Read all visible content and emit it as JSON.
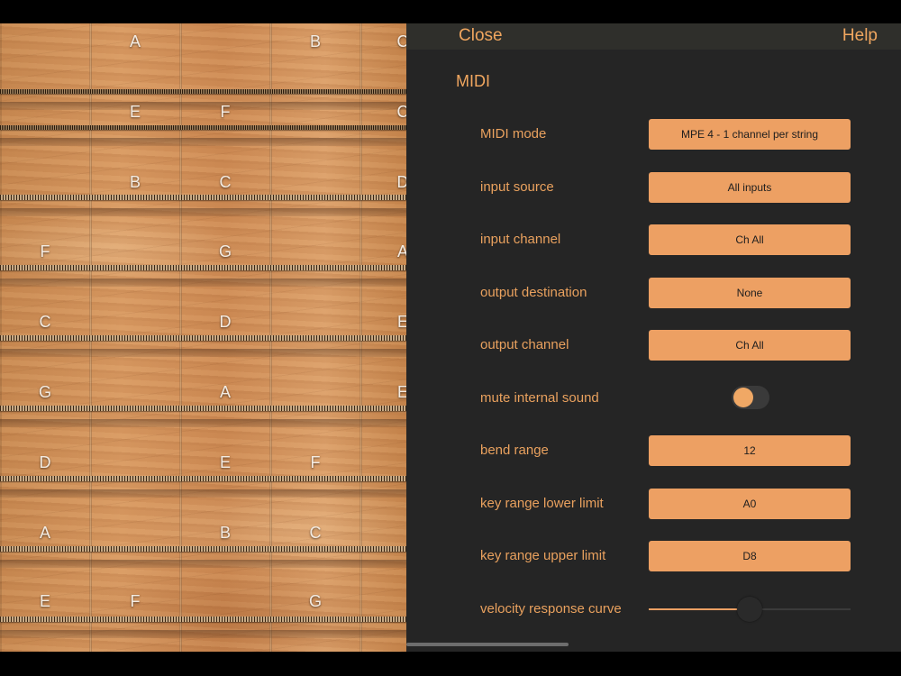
{
  "fretboard": {
    "notes": [
      [
        "",
        "A",
        "",
        "B",
        "C"
      ],
      [
        "",
        "E",
        "F",
        "",
        "C"
      ],
      [
        "",
        "B",
        "C",
        "",
        "D"
      ],
      [
        "F",
        "",
        "G",
        "",
        "A"
      ],
      [
        "C",
        "",
        "D",
        "",
        "E"
      ],
      [
        "G",
        "",
        "A",
        "",
        "E"
      ],
      [
        "D",
        "",
        "E",
        "F",
        ""
      ],
      [
        "A",
        "",
        "B",
        "C",
        ""
      ],
      [
        "E",
        "F",
        "",
        "G",
        ""
      ]
    ]
  },
  "topbar": {
    "close_label": "Close",
    "help_label": "Help"
  },
  "panel": {
    "section_title": "MIDI",
    "rows": [
      {
        "label": "MIDI mode",
        "value": "MPE 4 - 1 channel per string"
      },
      {
        "label": "input source",
        "value": "All inputs"
      },
      {
        "label": "input channel",
        "value": "Ch All"
      },
      {
        "label": "output destination",
        "value": "None"
      },
      {
        "label": "output channel",
        "value": "Ch All"
      },
      {
        "label": "mute internal sound",
        "toggle_on": false
      },
      {
        "label": "bend range",
        "value": "12"
      },
      {
        "label": "key range lower limit",
        "value": "A0"
      },
      {
        "label": "key range upper limit",
        "value": "D8"
      },
      {
        "label": "velocity response curve",
        "slider_value": 0.5
      }
    ]
  },
  "colors": {
    "accent": "#eda063",
    "panel_bg": "#252525",
    "topbar_bg": "#2f2f2b",
    "label_text": "#e9a15e"
  }
}
